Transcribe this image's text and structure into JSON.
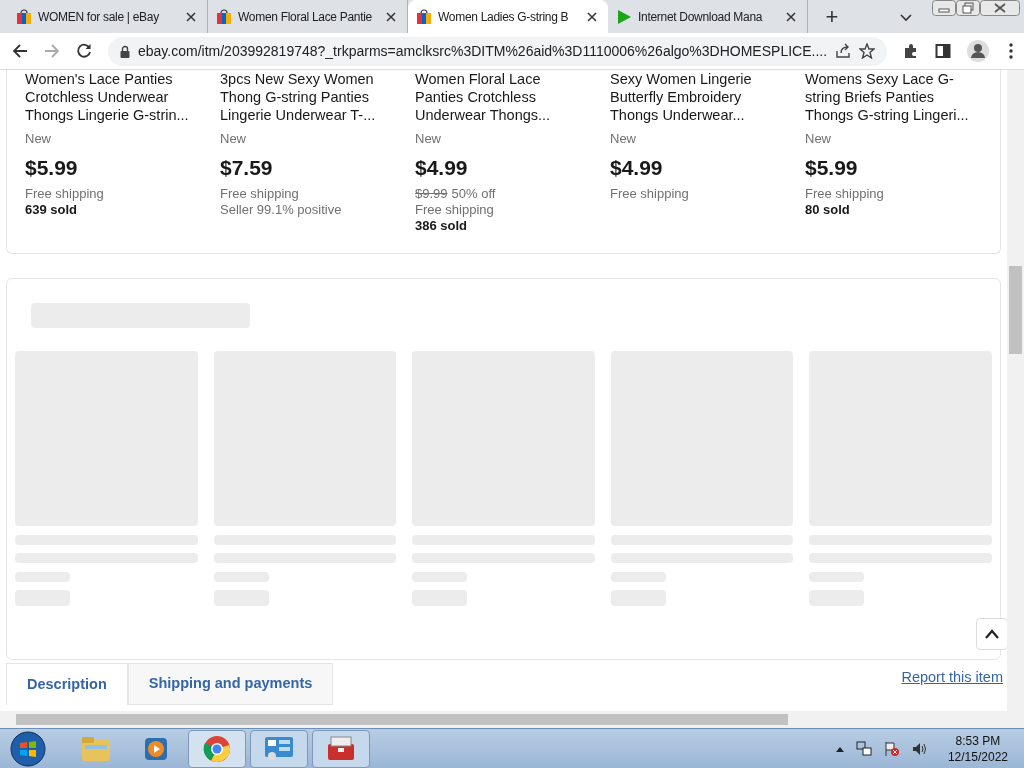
{
  "tabs": [
    {
      "title": "WOMEN for sale | eBay",
      "kind": "ebay",
      "selected": false
    },
    {
      "title": "Women Floral Lace Pantie",
      "kind": "ebay",
      "selected": false
    },
    {
      "title": "Women Ladies G-string B",
      "kind": "ebay",
      "selected": true
    },
    {
      "title": "Internet Download Mana",
      "kind": "idm",
      "selected": false
    }
  ],
  "new_tab": "+",
  "address": {
    "url": "ebay.com/itm/203992819748?_trkparms=amclksrc%3DITM%26aid%3D1110006%26algo%3DHOMESPLICE...."
  },
  "products": [
    {
      "title_lines": [
        "Women's Lace Panties",
        "Crotchless Underwear",
        "Thongs Lingerie G-strin..."
      ],
      "condition": "New",
      "price": "$5.99",
      "lines": [
        {
          "text": "Free shipping",
          "kind": "muted"
        },
        {
          "text": "639 sold",
          "kind": "bold"
        }
      ]
    },
    {
      "title_lines": [
        "3pcs New Sexy Women",
        "Thong G-string Panties",
        "Lingerie Underwear T-..."
      ],
      "condition": "New",
      "price": "$7.59",
      "lines": [
        {
          "text": "Free shipping",
          "kind": "muted"
        },
        {
          "text": "Seller 99.1% positive",
          "kind": "muted"
        }
      ]
    },
    {
      "title_lines": [
        "Women Floral Lace",
        "Panties Crotchless",
        "Underwear Thongs..."
      ],
      "condition": "New",
      "price": "$4.99",
      "original_price": "$9.99",
      "discount": "50% off",
      "lines": [
        {
          "text": "Free shipping",
          "kind": "muted"
        },
        {
          "text": "386 sold",
          "kind": "bold"
        }
      ]
    },
    {
      "title_lines": [
        "Sexy Women Lingerie",
        "Butterfly Embroidery",
        "Thongs Underwear..."
      ],
      "condition": "New",
      "price": "$4.99",
      "lines": [
        {
          "text": "Free shipping",
          "kind": "muted"
        }
      ]
    },
    {
      "title_lines": [
        "Womens Sexy Lace G-",
        "string Briefs Panties",
        "Thongs G-string Lingeri..."
      ],
      "condition": "New",
      "price": "$5.99",
      "lines": [
        {
          "text": "Free shipping",
          "kind": "muted"
        },
        {
          "text": "80 sold",
          "kind": "bold"
        }
      ]
    }
  ],
  "detail_tabs": [
    {
      "label": "Description",
      "selected": true
    },
    {
      "label": "Shipping and payments",
      "selected": false
    }
  ],
  "report_link": "Report this item",
  "clock": {
    "time": "8:53 PM",
    "date": "12/15/2022"
  }
}
